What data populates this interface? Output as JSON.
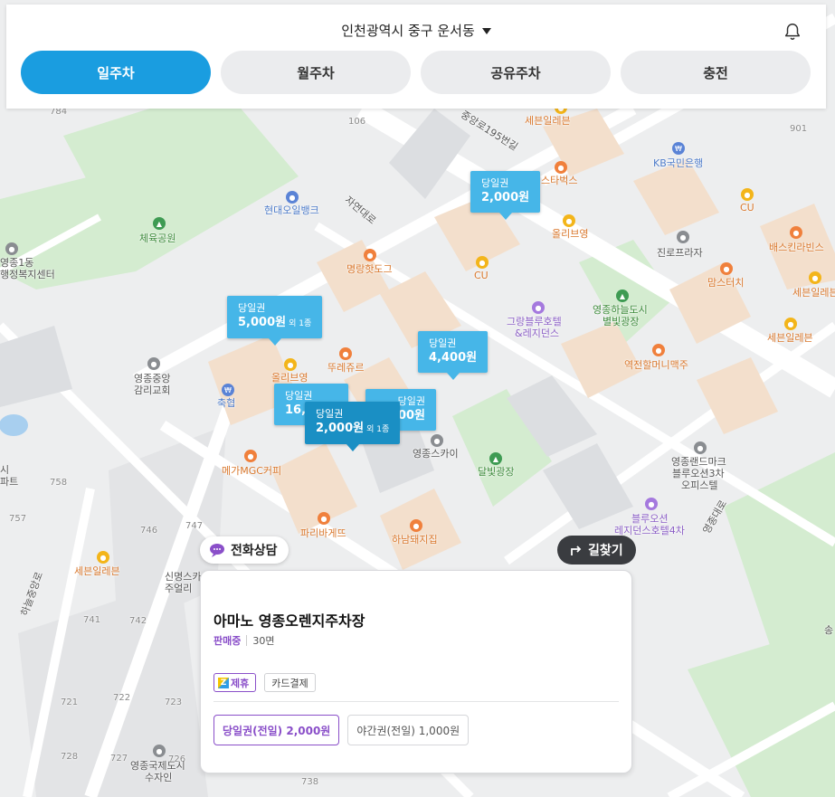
{
  "header": {
    "location": "인천광역시 중구 운서동",
    "tabs": [
      {
        "label": "일주차",
        "active": true
      },
      {
        "label": "월주차",
        "active": false
      },
      {
        "label": "공유주차",
        "active": false
      },
      {
        "label": "충전",
        "active": false
      }
    ]
  },
  "map": {
    "labels": {
      "n784": "784",
      "n106": "106",
      "n901": "901",
      "road_195": "중앙로195번길",
      "road_jayeon": "자연대로",
      "road_hanul": "하늘중앙로",
      "road_yeongjong": "영종대로",
      "sebang1": "세븐일레븐",
      "starbucks": "스타벅스",
      "kb": "KB국민은행",
      "hyundai_bank": "현대오일뱅크",
      "cu1": "CU",
      "cu2": "CU",
      "olive1": "올리브영",
      "olive2": "올리브영",
      "jinro": "진로프라자",
      "baskin": "배스킨라빈스",
      "mom": "맘스터치",
      "sebang2": "세븐일레븐",
      "sebang3": "세븐일레븐",
      "sebang4": "세븐일레븐",
      "park_gym": "체육공원",
      "yeongjong1": "영종1동",
      "welfare": "행정복지센터",
      "myungrang": "명랑핫도그",
      "grand_hotel": "그랑블루호텔",
      "residence": "&레지던스",
      "sky_park": "영종하늘도시",
      "byul_park": "별빛광장",
      "ttore": "뚜레쥬르",
      "church1": "영종중앙",
      "church2": "감리교회",
      "nh": "축협",
      "yeokjeon": "역전할머니맥주",
      "landmark1": "영종랜드마크",
      "landmark2": "블루오션3차",
      "landmark3": "오피스텔",
      "mega": "메가MGC커피",
      "sky": "영종스카이",
      "dalbit": "달빛광장",
      "si": "시",
      "apt": "파트",
      "n758": "758",
      "n757": "757",
      "n746": "746",
      "n747": "747",
      "paris": "파리바게뜨",
      "hanam": "하남돼지집",
      "blueocean1": "블루오션",
      "blueocean2": "레지던스호텔4차",
      "sinmyeong1": "신명스카",
      "sinmyeong2": "주얼리",
      "n741": "741",
      "n742": "742",
      "n721": "721",
      "n722": "722",
      "n723": "723",
      "n728": "728",
      "n727": "727",
      "n726": "726",
      "pool1": "영종국제도시",
      "pool2": "수자인",
      "n738": "738",
      "song": "송"
    },
    "pins": [
      {
        "type": "당일권",
        "price": "2,000원",
        "extra": ""
      },
      {
        "type": "당일권",
        "price": "5,000원",
        "extra": "외 1종"
      },
      {
        "type": "당일권",
        "price": "4,400원",
        "extra": ""
      },
      {
        "type": "당일권",
        "price": "16,5",
        "extra": ""
      },
      {
        "type": "당일권",
        "price": "00원",
        "extra": ""
      },
      {
        "type": "당일권",
        "price": "2,000원",
        "extra": "외 1종"
      }
    ]
  },
  "consult_label": "전화상담",
  "directions_label": "길찾기",
  "card": {
    "name": "아마노 영종오렌지주차장",
    "status": "판매중",
    "spaces": "30면",
    "tags": [
      {
        "label": "제휴",
        "icon": "Z"
      },
      {
        "label": "카드결제"
      }
    ],
    "tickets": [
      {
        "label": "당일권(전일) 2,000원",
        "selected": true
      },
      {
        "label": "야간권(전일) 1,000원",
        "selected": false
      }
    ]
  },
  "colors": {
    "accent": "#1a9de0",
    "pin": "#46b6e8",
    "pin_active": "#1a8fc4",
    "purple": "#8a4fc9"
  }
}
